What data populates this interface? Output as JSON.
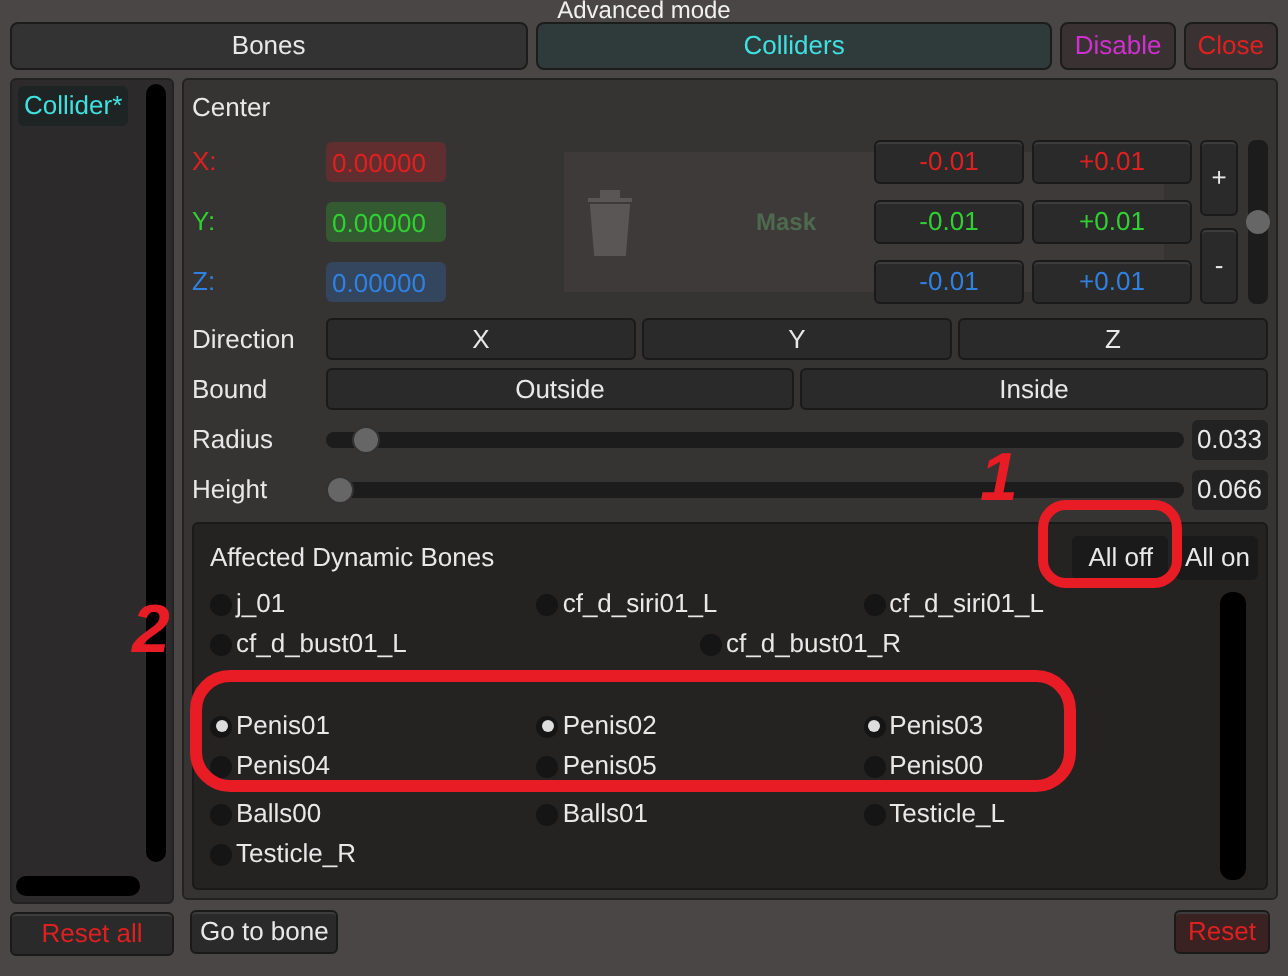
{
  "window": {
    "title": "Advanced mode"
  },
  "tabs": [
    {
      "label": "Bones",
      "selected": false
    },
    {
      "label": "Colliders",
      "selected": true
    }
  ],
  "header_buttons": [
    {
      "label": "Disable",
      "kind": "disable"
    },
    {
      "label": "Close",
      "kind": "close"
    }
  ],
  "sidebar": {
    "items": [
      {
        "label": "Collider*",
        "selected": true
      }
    ],
    "footer_button": "Reset all"
  },
  "background": {
    "label": "Mask"
  },
  "center": {
    "title": "Center",
    "axes": [
      {
        "label": "X:",
        "value": "0.00000",
        "color": "#e02020",
        "minus": "-0.01",
        "plus": "+0.01"
      },
      {
        "label": "Y:",
        "value": "0.00000",
        "color": "#30d030",
        "minus": "-0.01",
        "plus": "+0.01"
      },
      {
        "label": "Z:",
        "value": "0.00000",
        "color": "#3080e0",
        "minus": "-0.01",
        "plus": "+0.01"
      }
    ],
    "step_plus": "+",
    "step_minus": "-",
    "step_slider": {
      "level": 0.5
    }
  },
  "direction": {
    "label": "Direction",
    "options": [
      {
        "label": "X",
        "selected": false
      },
      {
        "label": "Y",
        "selected": false
      },
      {
        "label": "Z",
        "selected": false
      }
    ]
  },
  "bound": {
    "label": "Bound",
    "options": [
      {
        "label": "Outside",
        "selected": false
      },
      {
        "label": "Inside",
        "selected": false
      }
    ]
  },
  "sliders": [
    {
      "label": "Radius",
      "level": 0.03,
      "reading": "0.033"
    },
    {
      "label": "Height",
      "level": 0.0,
      "reading": "0.066"
    }
  ],
  "affected": {
    "title": "Affected Dynamic Bones",
    "all_off": "All off",
    "all_on": "All on",
    "rows": [
      [
        {
          "label": "j_01",
          "checked": false
        },
        {
          "label": "cf_d_siri01_L",
          "checked": false
        },
        {
          "label": "cf_d_siri01_L",
          "checked": false
        }
      ],
      [
        {
          "label": "cf_d_bust01_L",
          "checked": false
        },
        {
          "label": "cf_d_bust01_R",
          "checked": false
        }
      ],
      [
        {
          "label": "Penis01",
          "checked": true
        },
        {
          "label": "Penis02",
          "checked": true
        },
        {
          "label": "Penis03",
          "checked": true
        }
      ],
      [
        {
          "label": "Penis04",
          "checked": false
        },
        {
          "label": "Penis05",
          "checked": false
        },
        {
          "label": "Penis00",
          "checked": false
        }
      ],
      [
        {
          "label": "Balls00",
          "checked": false
        },
        {
          "label": "Balls01",
          "checked": false
        },
        {
          "label": "Testicle_L",
          "checked": false
        }
      ],
      [
        {
          "label": "Testicle_R",
          "checked": false
        }
      ]
    ]
  },
  "footer": {
    "go_to_bone": "Go to bone",
    "reset": "Reset"
  },
  "annotations": [
    {
      "label": "1"
    },
    {
      "label": "2"
    }
  ]
}
